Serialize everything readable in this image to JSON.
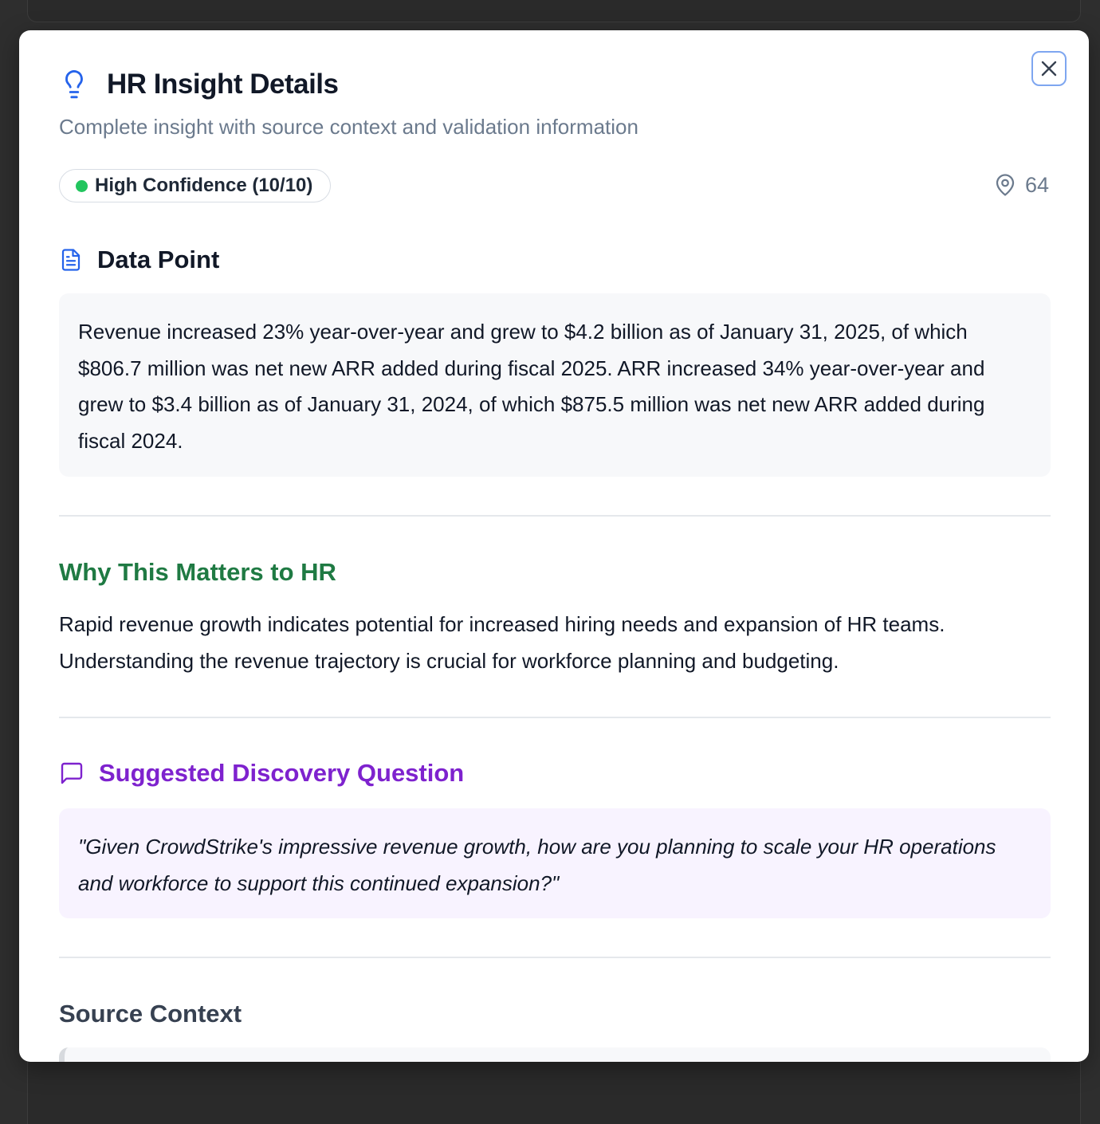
{
  "modal": {
    "title": "HR Insight Details",
    "subtitle": "Complete insight with source context and validation information",
    "close_icon": "close-icon",
    "title_icon": "lightbulb-icon"
  },
  "confidence": {
    "label": "High Confidence (10/10)",
    "status_color": "#22c55e"
  },
  "location": {
    "icon": "map-pin-icon",
    "value": "64"
  },
  "data_point": {
    "icon": "document-icon",
    "heading": "Data Point",
    "text": "Revenue increased 23% year-over-year and grew to $4.2 billion as of January 31, 2025, of which $806.7 million was net new ARR added during fiscal 2025. ARR increased 34% year-over-year and grew to $3.4 billion as of January 31, 2024, of which $875.5 million was net new ARR added during fiscal 2024."
  },
  "why": {
    "heading": "Why This Matters to HR",
    "text": "Rapid revenue growth indicates potential for increased hiring needs and expansion of HR teams. Understanding the revenue trajectory is crucial for workforce planning and budgeting.",
    "color": "#1f7a43"
  },
  "question": {
    "icon": "message-square-icon",
    "heading": "Suggested Discovery Question",
    "text": "\"Given CrowdStrike's impressive revenue growth, how are you planning to scale your HR operations and workforce to support this continued expansion?\"",
    "color": "#7e22ce"
  },
  "source": {
    "heading": "Source Context"
  },
  "colors": {
    "accent_blue": "#2563eb",
    "close_border": "#7ea6f0"
  }
}
